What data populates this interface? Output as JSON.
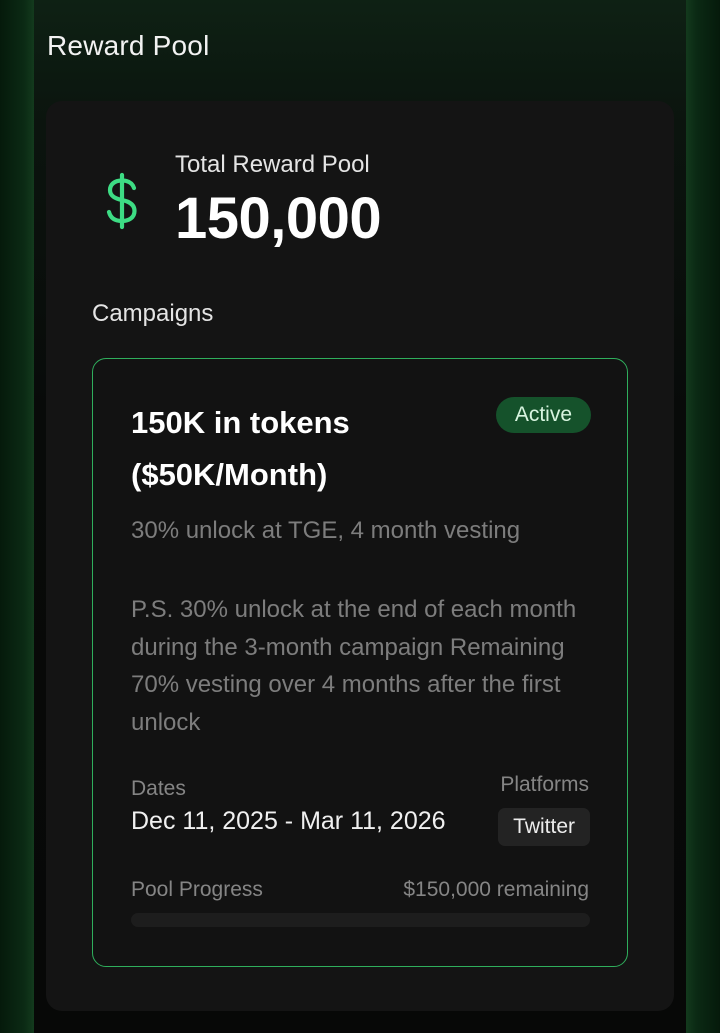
{
  "section_title": "Reward Pool",
  "pool": {
    "total_label": "Total Reward Pool",
    "total_value": "150,000",
    "icon": "dollar-icon",
    "accent_color": "#3ddc84"
  },
  "campaigns_label": "Campaigns",
  "campaign": {
    "title": "150K in tokens ($50K/Month)",
    "status": "Active",
    "subtitle": "30% unlock at TGE, 4 month vesting",
    "description": "P.S. 30% unlock at the end of each month during the 3-month campaign Remaining 70% vesting over 4 months after the first unlock",
    "dates_label": "Dates",
    "dates_value": "Dec 11, 2025 - Mar 11, 2026",
    "platforms_label": "Platforms",
    "platforms": [
      "Twitter"
    ],
    "progress_label": "Pool Progress",
    "progress_remaining": "$150,000 remaining",
    "progress_fraction": 0
  }
}
